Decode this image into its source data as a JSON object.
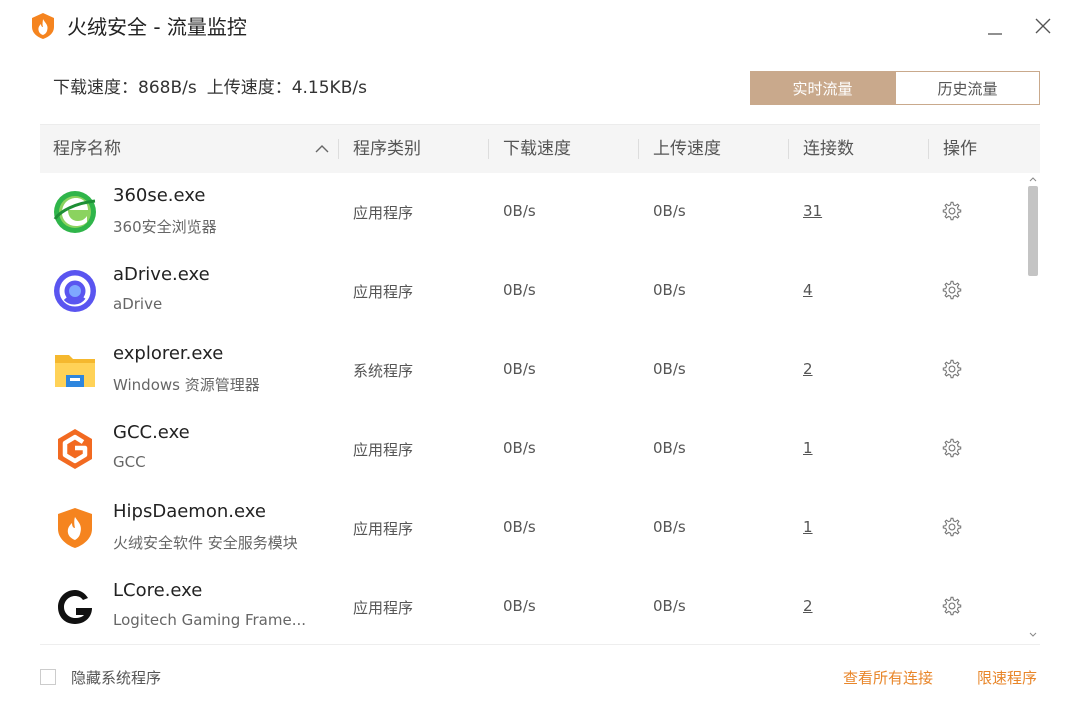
{
  "window": {
    "title": "火绒安全 - 流量监控",
    "brand_color": "#f5841f",
    "accent_color": "#c9a98c",
    "link_color": "#e8862a"
  },
  "summary": {
    "download_label": "下载速度：868B/s",
    "upload_label": "上传速度：4.15KB/s"
  },
  "tabs": [
    {
      "label": "实时流量",
      "active": true
    },
    {
      "label": "历史流量",
      "active": false
    }
  ],
  "table": {
    "headers": [
      "程序名称",
      "程序类别",
      "下载速度",
      "上传速度",
      "连接数",
      "操作"
    ],
    "rows": [
      {
        "name": "360se.exe",
        "desc": "360安全浏览器",
        "category": "应用程序",
        "download": "0B/s",
        "upload": "0B/s",
        "connections": "31",
        "icon": "360se-browser-icon"
      },
      {
        "name": "aDrive.exe",
        "desc": "aDrive",
        "category": "应用程序",
        "download": "0B/s",
        "upload": "0B/s",
        "connections": "4",
        "icon": "adrive-icon"
      },
      {
        "name": "explorer.exe",
        "desc": "Windows 资源管理器",
        "category": "系统程序",
        "download": "0B/s",
        "upload": "0B/s",
        "connections": "2",
        "icon": "folder-icon"
      },
      {
        "name": "GCC.exe",
        "desc": "GCC",
        "category": "应用程序",
        "download": "0B/s",
        "upload": "0B/s",
        "connections": "1",
        "icon": "gcc-icon"
      },
      {
        "name": "HipsDaemon.exe",
        "desc": "火绒安全软件 安全服务模块",
        "category": "应用程序",
        "download": "0B/s",
        "upload": "0B/s",
        "connections": "1",
        "icon": "huorong-shield-icon"
      },
      {
        "name": "LCore.exe",
        "desc": "Logitech Gaming Frame...",
        "category": "应用程序",
        "download": "0B/s",
        "upload": "0B/s",
        "connections": "2",
        "icon": "logitech-g-icon"
      }
    ]
  },
  "footer": {
    "hide_system_label": "隐藏系统程序",
    "view_all_label": "查看所有连接",
    "limit_label": "限速程序"
  }
}
